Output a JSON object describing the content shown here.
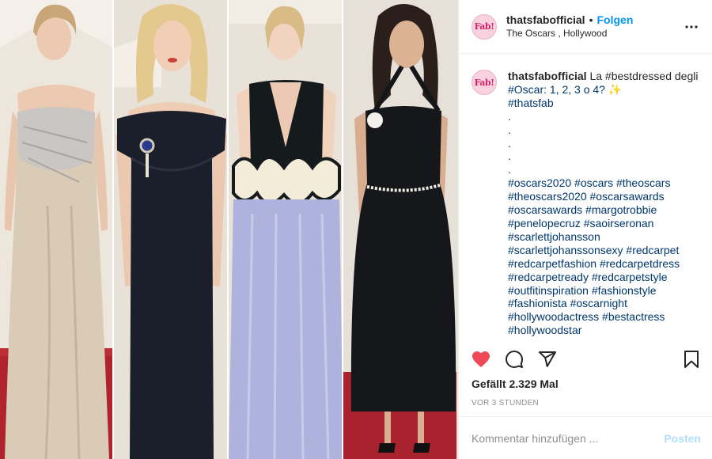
{
  "account": {
    "username": "thatsfabofficial",
    "avatar_text": "Fab!",
    "follow_label": "Folgen",
    "location": "The Oscars , Hollywood"
  },
  "caption": {
    "username": "thatsfabofficial",
    "lines": [
      "La #bestdressed degli",
      "#Oscar: 1, 2, 3 o 4? ✨",
      "#thatsfab",
      ".",
      ".",
      ".",
      ".",
      ".",
      "#oscars2020 #oscars #theoscars",
      "#theoscars2020 #oscarsawards",
      "#oscarsawards #margotrobbie",
      "#penelopecruz #saoirseronan",
      "#scarlettjohansson",
      "#scarlettjohanssonsexy #redcarpet",
      "#redcarpetfashion #redcarpetdress",
      "#redcarpetready #redcarpetstyle",
      "#outfitinspiration #fashionstyle",
      "#fashionista #oscarnight",
      "#hollywoodactress #bestactress",
      "#hollywoodstar"
    ]
  },
  "stats": {
    "likes": "Gefällt 2.329 Mal",
    "time": "VOR 3 STUNDEN"
  },
  "comment": {
    "placeholder": "Kommentar hinzufügen ...",
    "post_label": "Posten"
  },
  "icons": {
    "like": "heart-filled-icon",
    "comment": "comment-bubble-icon",
    "share": "paper-plane-icon",
    "save": "bookmark-icon",
    "more": "more-options-icon"
  },
  "colors": {
    "like": "#ed4956",
    "follow": "#0095f6",
    "hashtag": "#00376b",
    "post_disabled": "#b2dffc",
    "avatar_bg": "#f9d1df",
    "avatar_text": "#d2246c"
  }
}
